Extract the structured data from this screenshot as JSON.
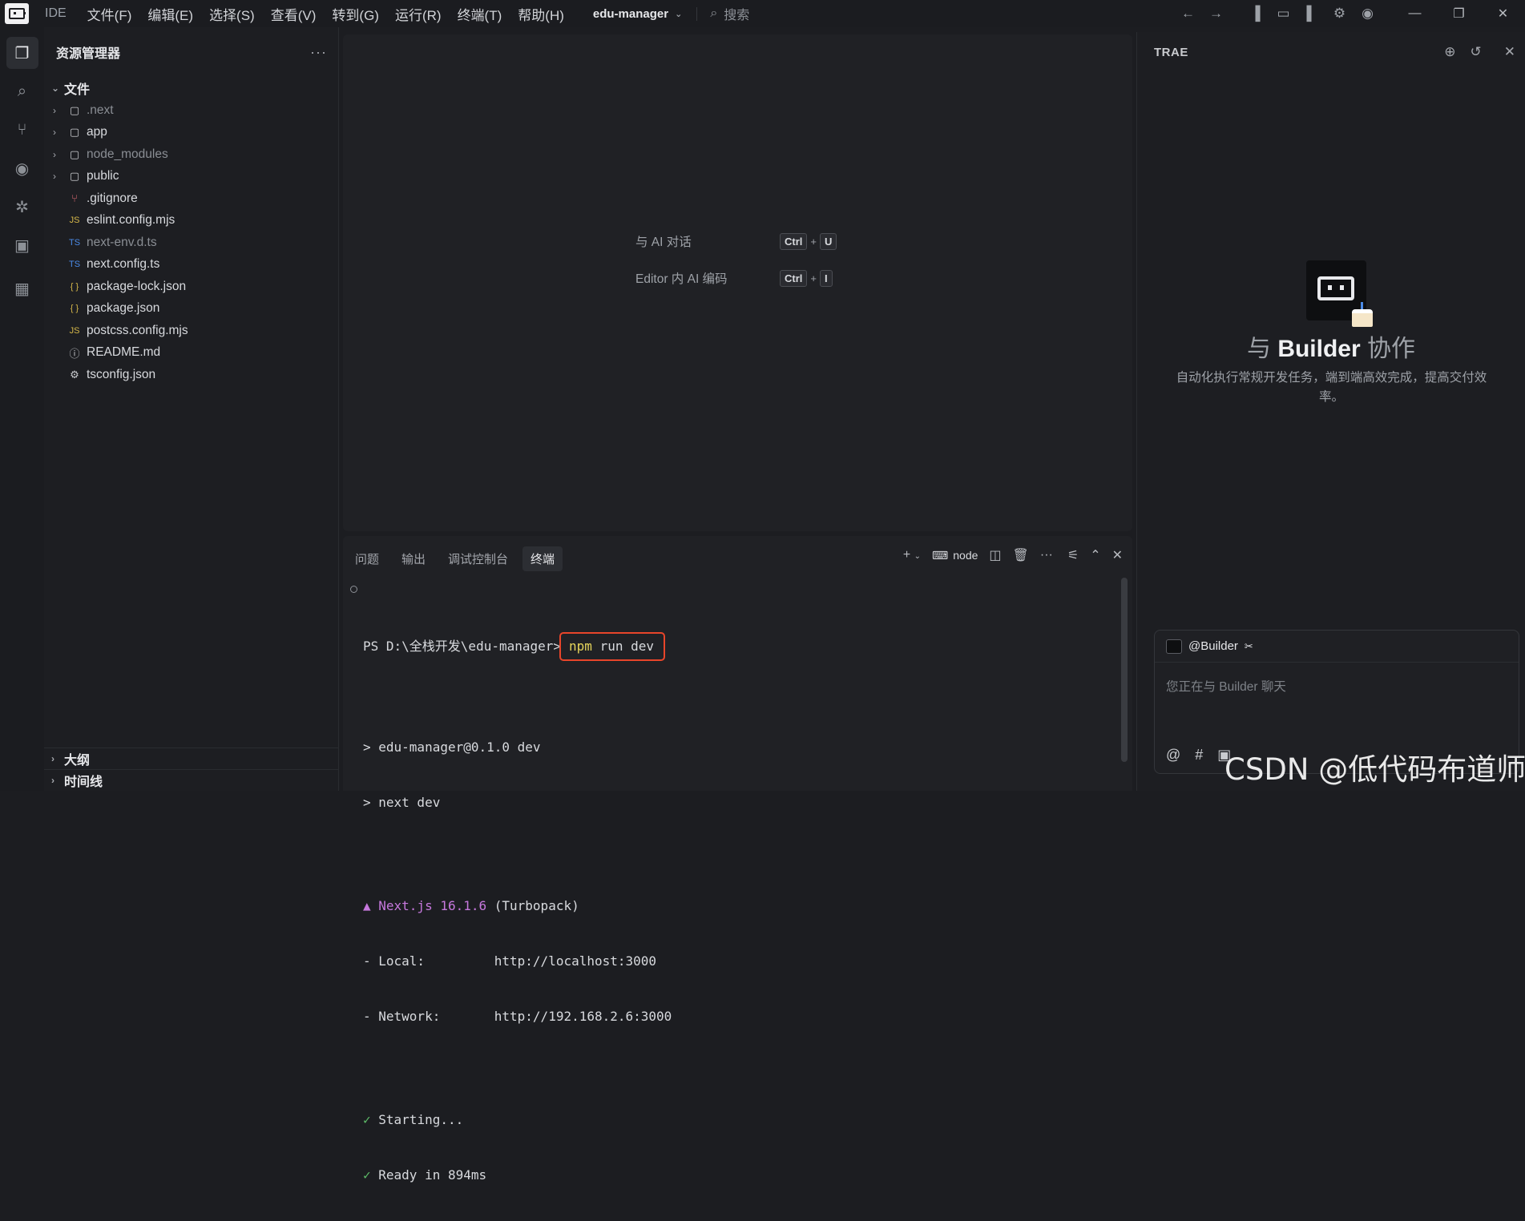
{
  "titlebar": {
    "ide_label": "IDE",
    "menu": [
      "文件(F)",
      "编辑(E)",
      "选择(S)",
      "查看(V)",
      "转到(G)",
      "运行(R)",
      "终端(T)",
      "帮助(H)"
    ],
    "project": "edu-manager",
    "search_placeholder": "搜索"
  },
  "explorer": {
    "title": "资源管理器",
    "section_files": "文件",
    "items": [
      {
        "name": ".next",
        "type": "folder",
        "dim": true
      },
      {
        "name": "app",
        "type": "folder",
        "dim": false
      },
      {
        "name": "node_modules",
        "type": "folder",
        "dim": true
      },
      {
        "name": "public",
        "type": "folder",
        "dim": false
      },
      {
        "name": ".gitignore",
        "type": "git",
        "dim": false
      },
      {
        "name": "eslint.config.mjs",
        "type": "js",
        "dim": false
      },
      {
        "name": "next-env.d.ts",
        "type": "ts",
        "dim": true
      },
      {
        "name": "next.config.ts",
        "type": "ts",
        "dim": false
      },
      {
        "name": "package-lock.json",
        "type": "json",
        "dim": false
      },
      {
        "name": "package.json",
        "type": "json",
        "dim": false
      },
      {
        "name": "postcss.config.mjs",
        "type": "js",
        "dim": false
      },
      {
        "name": "README.md",
        "type": "info",
        "dim": false
      },
      {
        "name": "tsconfig.json",
        "type": "gear",
        "dim": false
      }
    ],
    "outline": "大纲",
    "timeline": "时间线"
  },
  "editor": {
    "shortcut1_label": "与 AI 对话",
    "shortcut1_key1": "Ctrl",
    "shortcut1_key2": "U",
    "shortcut2_label": "Editor 内 AI 编码",
    "shortcut2_key1": "Ctrl",
    "shortcut2_key2": "I"
  },
  "terminal": {
    "tabs": [
      "问题",
      "输出",
      "调试控制台",
      "终端"
    ],
    "active_tab": "终端",
    "shell_label": "node",
    "prompt": "PS D:\\全栈开发\\edu-manager>",
    "command_npm": "npm",
    "command_rest": " run dev",
    "line1": "> edu-manager@0.1.0 dev",
    "line2": "> next dev",
    "next_label": "▲ Next.js 16.1.6",
    "next_rest": " (Turbopack)",
    "local": "- Local:         http://localhost:3000",
    "network": "- Network:       http://192.168.2.6:3000",
    "starting": " Starting...",
    "ready": " Ready in 894ms",
    "check": "✓"
  },
  "right_panel": {
    "title": "TRAE",
    "heading_prefix": "与 ",
    "heading_bold": "Builder",
    "heading_suffix": " 协作",
    "description": "自动化执行常规开发任务，端到端高效完成，提高交付效率。",
    "chat_agent": "@Builder",
    "chat_placeholder": "您正在与 Builder 聊天"
  },
  "watermark": "CSDN @低代码布道师"
}
